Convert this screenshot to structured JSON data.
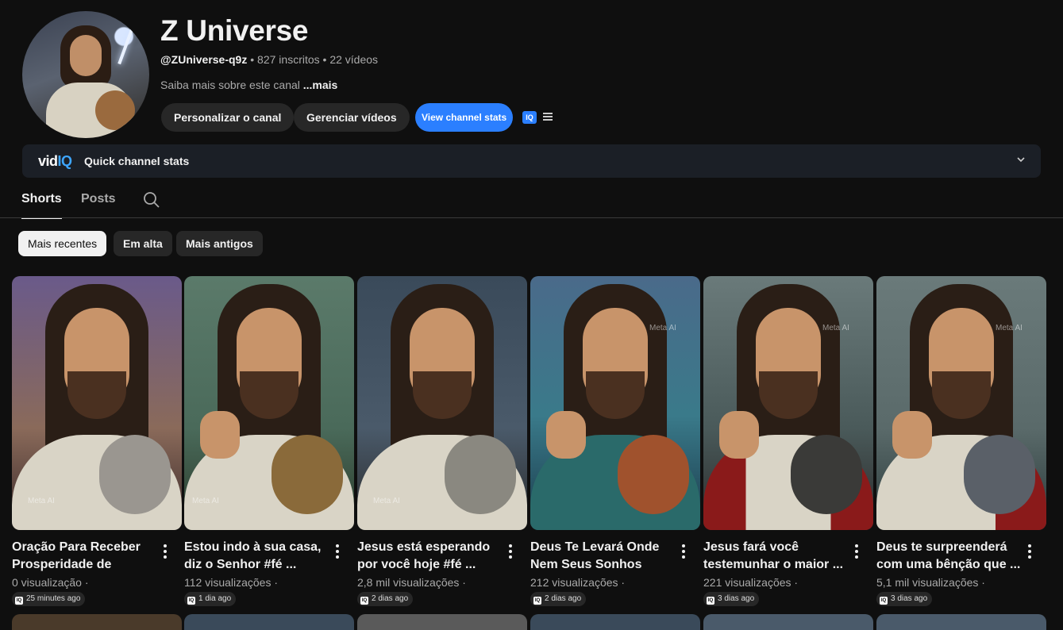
{
  "channel": {
    "name": "Z Universe",
    "handle": "@ZUniverse-q9z",
    "subscribers": "827 inscritos",
    "videos": "22 vídeos",
    "separator": "•",
    "about": "Saiba mais sobre este canal",
    "about_more": "...mais"
  },
  "actions": {
    "customize": "Personalizar o canal",
    "manage": "Gerenciar vídeos",
    "stats": "View channel stats",
    "iq_badge": "IQ"
  },
  "vidiq": {
    "logo_left": "vid",
    "logo_right": "IQ",
    "label": "Quick channel stats"
  },
  "tabs": [
    "Shorts",
    "Posts"
  ],
  "chips": [
    "Mais recentes",
    "Em alta",
    "Mais antigos"
  ],
  "colors": {
    "background": "#0f0f0f",
    "accent_blue": "#2b7fff",
    "chip": "#272727"
  },
  "videos": [
    {
      "title": "Oração Para Receber Prosperidade de Form...",
      "views": "0 visualização ·",
      "ago": "25 minutes ago",
      "watermark": "Meta AI"
    },
    {
      "title": "Estou indo à sua casa, diz o Senhor #fé ...",
      "views": "112 visualizações ·",
      "ago": "1 dia ago",
      "watermark": "Meta AI"
    },
    {
      "title": "Jesus está esperando por você hoje #fé ...",
      "views": "2,8 mil visualizações ·",
      "ago": "2 dias ago",
      "watermark": "Meta AI"
    },
    {
      "title": "Deus Te Levará Onde Nem Seus Sonhos Mai...",
      "views": "212 visualizações ·",
      "ago": "2 dias ago",
      "watermark": "Meta AI"
    },
    {
      "title": "Jesus fará você testemunhar o maior ...",
      "views": "221 visualizações ·",
      "ago": "3 dias ago",
      "watermark": "Meta AI"
    },
    {
      "title": "Deus te surpreenderá com uma bênção que ...",
      "views": "5,1 mil visualizações ·",
      "ago": "3 dias ago",
      "watermark": "Meta AI"
    }
  ],
  "icons": [
    "search-icon",
    "menu-icon",
    "chevron-down-icon",
    "kebab-icon"
  ]
}
